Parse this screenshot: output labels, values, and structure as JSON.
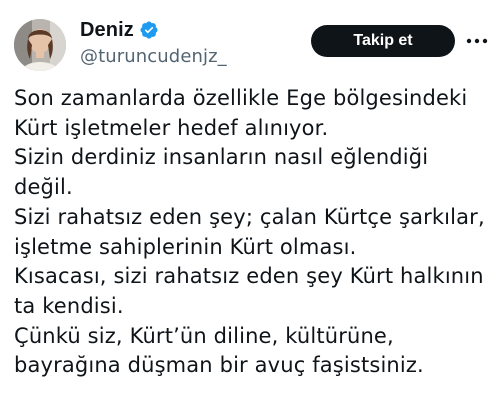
{
  "author": {
    "display_name": "Deniz",
    "handle": "@turuncudenjz_",
    "verified": true,
    "verified_color": "#1d9bf0",
    "avatar_icon": "profile-photo"
  },
  "actions": {
    "follow_label": "Takip et",
    "more_icon": "horizontal-ellipsis-icon"
  },
  "tweet": {
    "lines": [
      "Son zamanlarda özellikle Ege bölgesindeki",
      "Kürt işletmeler hedef alınıyor.",
      "Sizin derdiniz insanların nasıl eğlendiği",
      "değil.",
      "Sizi rahatsız eden şey; çalan Kürtçe şarkılar,",
      "işletme sahiplerinin Kürt olması.",
      "Kısacası, sizi rahatsız eden şey Kürt halkının",
      "ta kendisi.",
      "Çünkü siz, Kürt’ün diline, kültürüne,",
      "bayrağına düşman bir avuç faşistsiniz."
    ]
  },
  "colors": {
    "text": "#0f1419",
    "secondary": "#536471",
    "button_bg": "#0f1419",
    "button_text": "#ffffff"
  }
}
